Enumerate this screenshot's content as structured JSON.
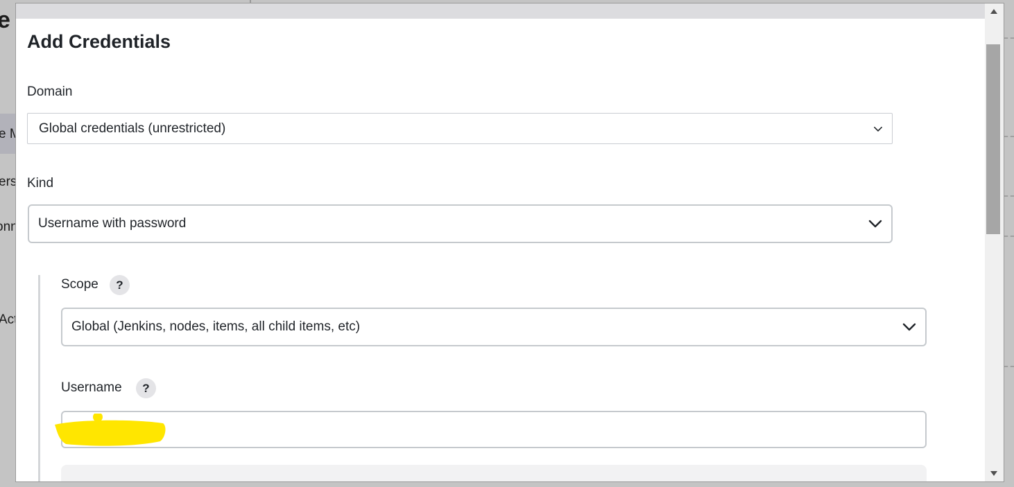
{
  "background": {
    "title_fragment": "e",
    "sidebar_fragments": [
      "e M",
      "ers",
      "onn",
      "Act"
    ]
  },
  "dialog": {
    "title": "Add Credentials",
    "domain": {
      "label": "Domain",
      "selected": "Global credentials (unrestricted)"
    },
    "kind": {
      "label": "Kind",
      "selected": "Username with password"
    },
    "scope": {
      "label": "Scope",
      "help": "?",
      "selected": "Global (Jenkins, nodes, items, all child items, etc)"
    },
    "username": {
      "label": "Username",
      "help": "?",
      "value": ""
    }
  },
  "colors": {
    "redaction": "#ffe600",
    "input_border": "#c5c9cd",
    "help_bg": "#e4e4e7"
  },
  "icons": [
    "chevron-down-icon",
    "help-icon",
    "scroll-up-arrow-icon",
    "scroll-down-arrow-icon"
  ]
}
